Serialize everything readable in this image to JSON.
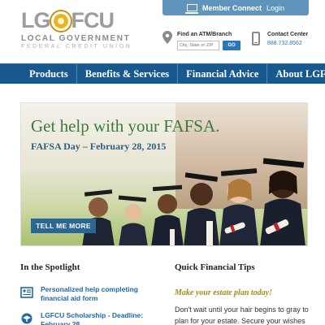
{
  "logo": {
    "name": "LGFCU",
    "subtitle_line1": "LOCAL GOVERNMENT",
    "subtitle_line2": "FEDERAL CREDIT UNION"
  },
  "header": {
    "member_connect_bold": "Member Connect",
    "member_connect_normal": "Login",
    "atm_label": "Find an ATM/Branch",
    "atm_placeholder": "City, State or ZIP",
    "go_label": "GO",
    "contact_label": "Contact Center",
    "contact_phone": "888.732.8562"
  },
  "nav": {
    "items": [
      {
        "label": "Products"
      },
      {
        "label": "Benefits & Services"
      },
      {
        "label": "Financial Advice"
      },
      {
        "label": "About LGFCU"
      }
    ]
  },
  "hero": {
    "title": "Get help with your FAFSA.",
    "subtitle": "FAFSA Day – February 28, 2015",
    "cta_label": "TELL ME MORE"
  },
  "spotlight": {
    "title": "In the Spotlight",
    "items": [
      {
        "text": "Personalized help completing financial aid form",
        "icon": "document-icon"
      },
      {
        "text": "LGFCU Scholarship - Deadline: February 28",
        "icon": "scholarship-icon"
      }
    ]
  },
  "tips": {
    "title": "Quick Financial Tips",
    "headline": "Make your estate plan today!",
    "body": "Don't wait until your hair begins to gray to plan for your estate. Secure your wishes"
  },
  "colors": {
    "nav_bg": "#17598f",
    "accent_blue": "#2068a6",
    "hero_green": "#3d7a3d",
    "tip_gold": "#9a8f20",
    "member_btn": "#5f95bd"
  }
}
